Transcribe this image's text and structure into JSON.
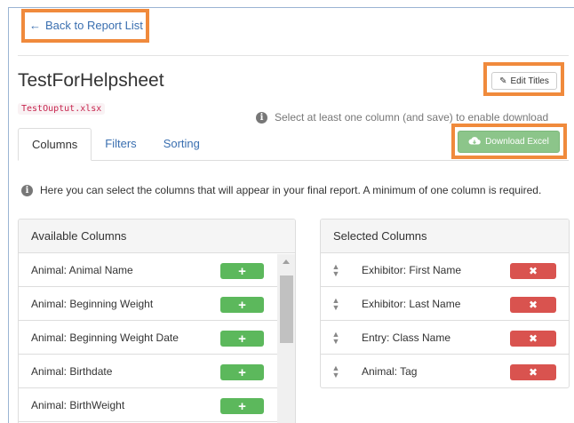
{
  "nav": {
    "back_label": "Back to Report List"
  },
  "report": {
    "title": "TestForHelpsheet",
    "file_name": "TestOuptut.xlsx"
  },
  "actions": {
    "edit_titles": "Edit Titles",
    "download_excel": "Download Excel",
    "download_hint": "Select at least one column (and save) to enable download"
  },
  "tabs": [
    {
      "label": "Columns",
      "active": true
    },
    {
      "label": "Filters",
      "active": false
    },
    {
      "label": "Sorting",
      "active": false
    }
  ],
  "info_text": "Here you can select the columns that will appear in your final report. A minimum of one column is required.",
  "available": {
    "heading": "Available Columns",
    "items": [
      "Animal: Animal Name",
      "Animal: Beginning Weight",
      "Animal: Beginning Weight Date",
      "Animal: Birthdate",
      "Animal: BirthWeight"
    ]
  },
  "selected": {
    "heading": "Selected Columns",
    "items": [
      "Exhibitor: First Name",
      "Exhibitor: Last Name",
      "Entry: Class Name",
      "Animal: Tag"
    ]
  },
  "colors": {
    "accent_link": "#3a6fb0",
    "highlight": "#f08a3c",
    "add_green": "#5cb85c",
    "download_green": "#8cc58a",
    "remove_red": "#d9534f"
  }
}
